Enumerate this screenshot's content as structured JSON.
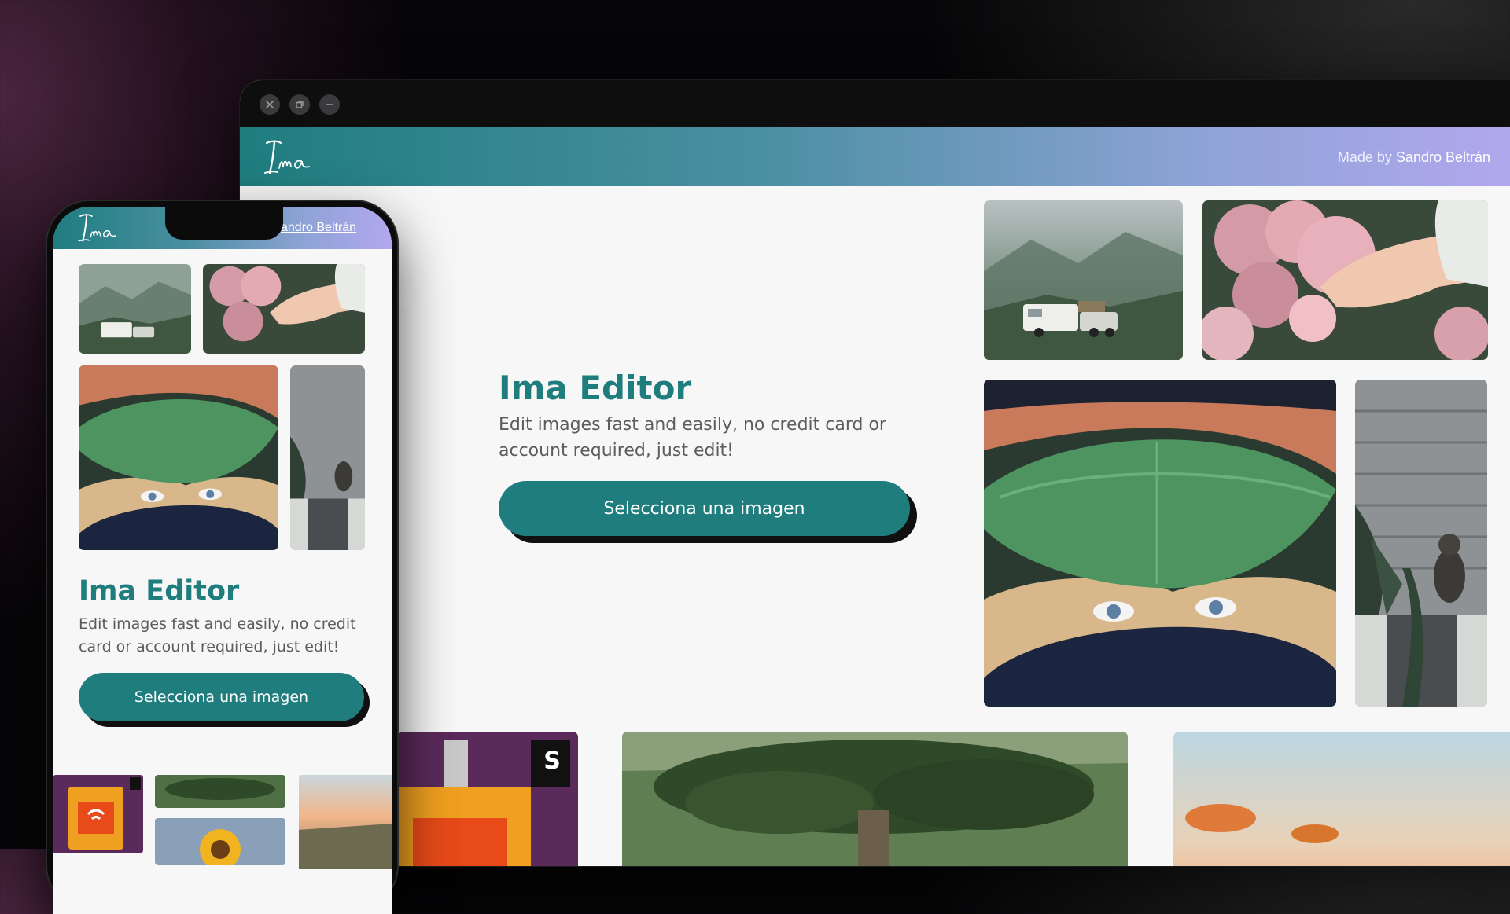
{
  "window": {
    "controls": [
      {
        "name": "close-window-button",
        "icon": "close-icon"
      },
      {
        "name": "restore-window-button",
        "icon": "restore-icon"
      },
      {
        "name": "minimize-window-button",
        "icon": "minimize-icon"
      }
    ]
  },
  "brand": {
    "logo_text": "Ima",
    "accent_color": "#1f7d7e",
    "header_gradient": [
      "#1f7d7e",
      "#b3a8ef"
    ]
  },
  "desktop": {
    "header": {
      "made_by_prefix": "Made by",
      "author": "Sandro Beltrán"
    },
    "hero": {
      "title": "Ima Editor",
      "description": "Edit images fast and easily, no credit card or account required, just edit!",
      "cta_label": "Selecciona una imagen"
    },
    "gallery": [
      {
        "name": "photo-camper-mountains"
      },
      {
        "name": "photo-hydrangea-hand"
      },
      {
        "name": "photo-leaf-face"
      },
      {
        "name": "photo-cat-plants"
      },
      {
        "name": "photo-camera-gadget"
      },
      {
        "name": "photo-dragon-tree"
      },
      {
        "name": "photo-sunset-sky"
      }
    ]
  },
  "mobile": {
    "header": {
      "author_visible": "andro Beltrán"
    },
    "hero": {
      "title": "Ima Editor",
      "description": "Edit images fast and easily, no credit card or account required, just edit!",
      "cta_label": "Selecciona una imagen"
    },
    "camera_badge_text": "S"
  }
}
